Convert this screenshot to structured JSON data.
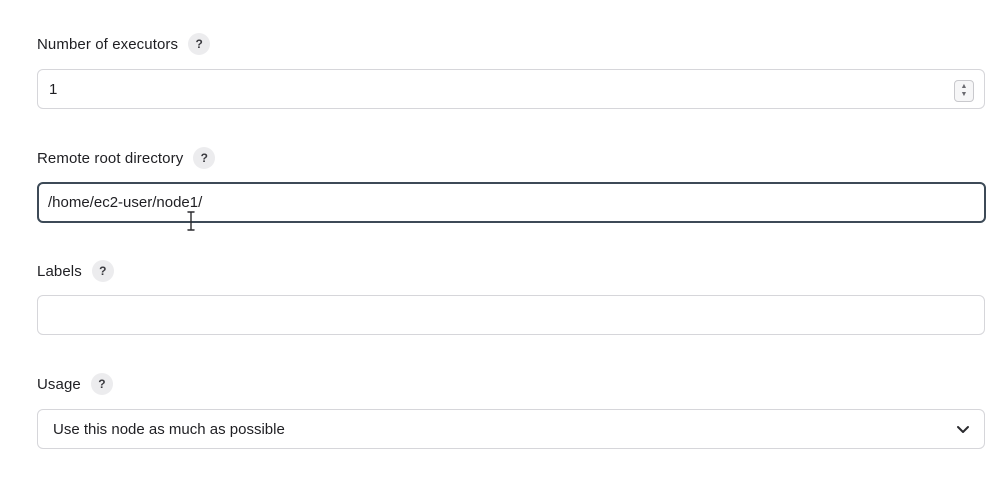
{
  "fields": {
    "executors": {
      "label": "Number of executors",
      "help": "?",
      "value": "1"
    },
    "remote_root": {
      "label": "Remote root directory",
      "help": "?",
      "value": "/home/ec2-user/node1/"
    },
    "labels": {
      "label": "Labels",
      "help": "?",
      "value": ""
    },
    "usage": {
      "label": "Usage",
      "help": "?",
      "selected": "Use this node as much as possible"
    }
  },
  "icons": {
    "help": "question-mark-icon",
    "spinner": "number-spinner-icon",
    "dropdown": "chevron-down-icon",
    "cursor": "text-cursor-icon"
  },
  "colors": {
    "focus_border": "#3d4a57",
    "border": "#d6d6da",
    "help_bg": "#ececee"
  }
}
